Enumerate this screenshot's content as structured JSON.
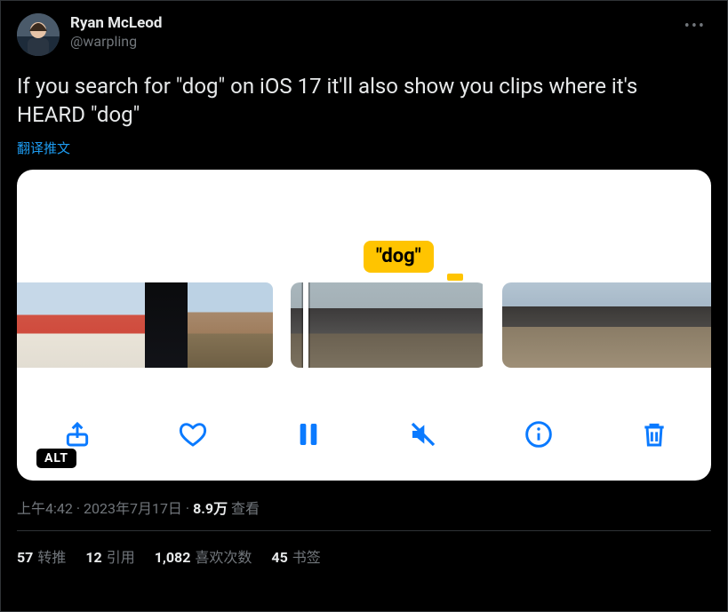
{
  "user": {
    "display_name": "Ryan McLeod",
    "handle": "@warpling"
  },
  "tweet": {
    "text": "If you search for \"dog\" on iOS 17 it'll also show you clips where it's HEARD \"dog\"",
    "translate_label": "翻译推文"
  },
  "media": {
    "search_bubble": "\"dog\"",
    "alt_badge": "ALT",
    "toolbar": {
      "share": "share-icon",
      "like": "heart-icon",
      "pause": "pause-icon",
      "mute": "speaker-muted-icon",
      "info": "info-icon",
      "delete": "trash-icon"
    }
  },
  "meta": {
    "time": "上午4:42",
    "dot1": " · ",
    "date": "2023年7月17日",
    "dot2": " · ",
    "views_count": "8.9万",
    "views_label": " 查看"
  },
  "stats": {
    "retweets": {
      "count": "57",
      "label": "转推"
    },
    "quotes": {
      "count": "12",
      "label": "引用"
    },
    "likes": {
      "count": "1,082",
      "label": "喜欢次数"
    },
    "bookmarks": {
      "count": "45",
      "label": "书签"
    }
  }
}
